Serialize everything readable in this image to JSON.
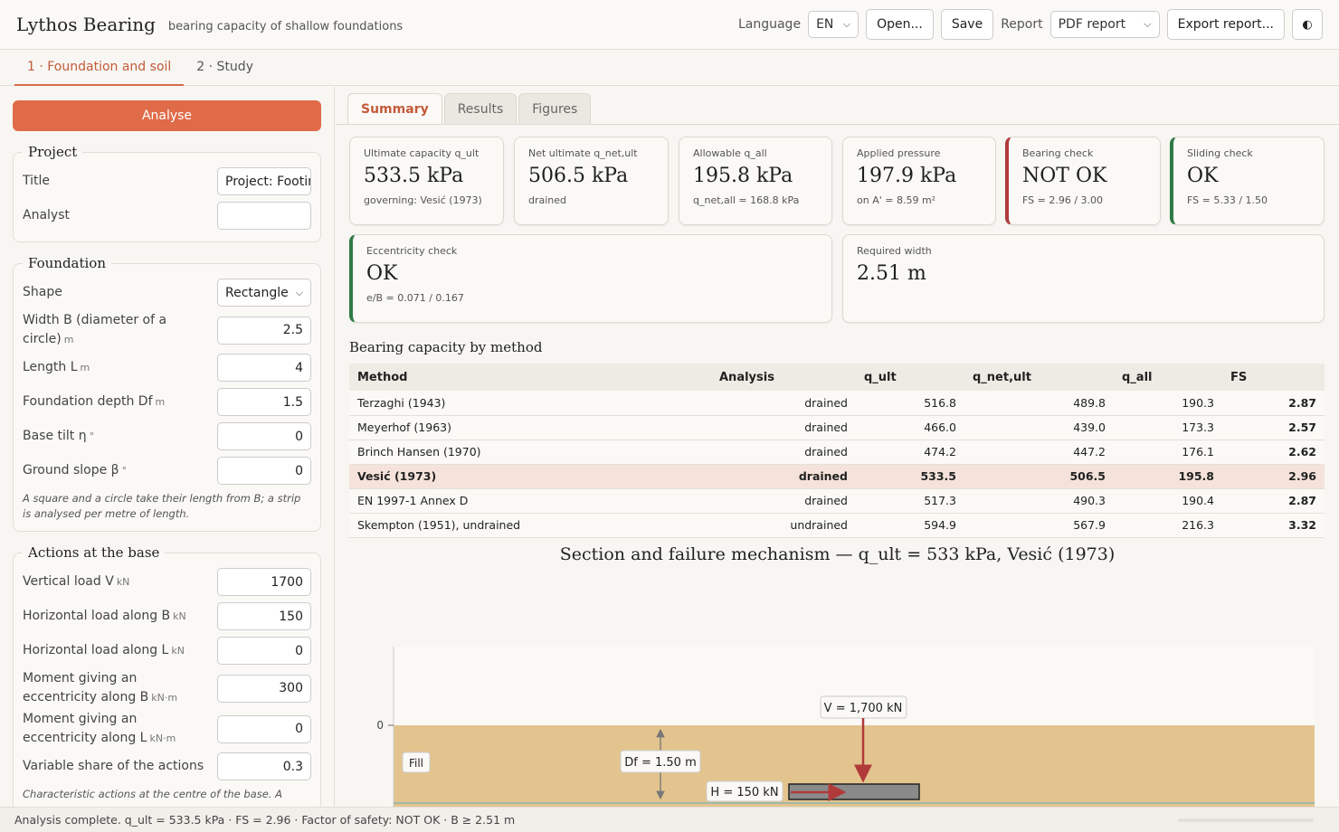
{
  "header": {
    "title": "Lythos Bearing",
    "subtitle": "bearing capacity of shallow foundations",
    "language_label": "Language",
    "language_value": "EN",
    "open_label": "Open...",
    "save_label": "Save",
    "report_label": "Report",
    "report_value": "PDF report",
    "export_label": "Export report...",
    "theme_icon": "◐"
  },
  "steps": [
    {
      "label": "1 · Foundation and soil",
      "active": true
    },
    {
      "label": "2 · Study",
      "active": false
    }
  ],
  "sidebar": {
    "analyse_label": "Analyse",
    "project": {
      "legend": "Project",
      "title_label": "Title",
      "title_value": "Project: Footing",
      "analyst_label": "Analyst",
      "analyst_value": ""
    },
    "foundation": {
      "legend": "Foundation",
      "shape_label": "Shape",
      "shape_value": "Rectangle",
      "width_label": "Width B (diameter of a circle)",
      "width_unit": "m",
      "width_value": "2.5",
      "length_label": "Length L",
      "length_unit": "m",
      "length_value": "4",
      "depth_label": "Foundation depth Df",
      "depth_unit": "m",
      "depth_value": "1.5",
      "tilt_label": "Base tilt η",
      "tilt_unit": "°",
      "tilt_value": "0",
      "slope_label": "Ground slope β",
      "slope_unit": "°",
      "slope_value": "0",
      "note": "A square and a circle take their length from B; a strip is analysed per metre of length."
    },
    "actions": {
      "legend": "Actions at the base",
      "v_label": "Vertical load V",
      "v_unit": "kN",
      "v_value": "1700",
      "hb_label": "Horizontal load along B",
      "hb_unit": "kN",
      "hb_value": "150",
      "hl_label": "Horizontal load along L",
      "hl_unit": "kN",
      "hl_value": "0",
      "mb_label": "Moment giving an eccentricity along B",
      "mb_unit": "kN·m",
      "mb_value": "300",
      "ml_label": "Moment giving an eccentricity along L",
      "ml_unit": "kN·m",
      "ml_value": "0",
      "var_label": "Variable share of the actions",
      "var_value": "0.3",
      "note": "Characteristic actions at the centre of the base. A"
    }
  },
  "tabs": [
    {
      "label": "Summary",
      "active": true
    },
    {
      "label": "Results",
      "active": false
    },
    {
      "label": "Figures",
      "active": false
    }
  ],
  "cards": {
    "qult": {
      "title": "Ultimate capacity q_ult",
      "value": "533.5 kPa",
      "sub": "governing: Vesić (1973)"
    },
    "qnet": {
      "title": "Net ultimate q_net,ult",
      "value": "506.5 kPa",
      "sub": "drained"
    },
    "qall": {
      "title": "Allowable q_all",
      "value": "195.8 kPa",
      "sub": "q_net,all = 168.8 kPa"
    },
    "applied": {
      "title": "Applied pressure",
      "value": "197.9 kPa",
      "sub": "on A' = 8.59 m²"
    },
    "bearing": {
      "title": "Bearing check",
      "value": "NOT OK",
      "sub": "FS = 2.96 / 3.00"
    },
    "sliding": {
      "title": "Sliding check",
      "value": "OK",
      "sub": "FS = 5.33 / 1.50"
    },
    "ecc": {
      "title": "Eccentricity check",
      "value": "OK",
      "sub": "e/B = 0.071 / 0.167"
    },
    "width": {
      "title": "Required width",
      "value": "2.51 m"
    }
  },
  "methods": {
    "title": "Bearing capacity by method",
    "columns": [
      "Method",
      "Analysis",
      "q_ult",
      "q_net,ult",
      "q_all",
      "FS"
    ],
    "rows": [
      {
        "method": "Terzaghi (1943)",
        "analysis": "drained",
        "qult": "516.8",
        "qnet": "489.8",
        "qall": "190.3",
        "fs": "2.87",
        "ok": false,
        "highlight": false
      },
      {
        "method": "Meyerhof (1963)",
        "analysis": "drained",
        "qult": "466.0",
        "qnet": "439.0",
        "qall": "173.3",
        "fs": "2.57",
        "ok": false,
        "highlight": false
      },
      {
        "method": "Brinch Hansen (1970)",
        "analysis": "drained",
        "qult": "474.2",
        "qnet": "447.2",
        "qall": "176.1",
        "fs": "2.62",
        "ok": false,
        "highlight": false
      },
      {
        "method": "Vesić (1973)",
        "analysis": "drained",
        "qult": "533.5",
        "qnet": "506.5",
        "qall": "195.8",
        "fs": "2.96",
        "ok": false,
        "highlight": true
      },
      {
        "method": "EN 1997-1 Annex D",
        "analysis": "drained",
        "qult": "517.3",
        "qnet": "490.3",
        "qall": "190.4",
        "fs": "2.87",
        "ok": false,
        "highlight": false
      },
      {
        "method": "Skempton (1951), undrained",
        "analysis": "undrained",
        "qult": "594.9",
        "qnet": "567.9",
        "qall": "216.3",
        "fs": "3.32",
        "ok": true,
        "highlight": false
      }
    ]
  },
  "figure": {
    "title": "Section and failure mechanism — q_ult = 533 kPa, Vesić (1973)",
    "y_tick": "0",
    "fill_label": "Fill",
    "v_label": "V = 1,700 kN",
    "df_label": "Df = 1.50 m",
    "h_label": "H = 150 kN",
    "colors": {
      "soil": "#e3c48e",
      "footing": "#8a8a8a",
      "arrow": "#b03a3a"
    }
  },
  "status": "Analysis complete. q_ult = 533.5 kPa · FS = 2.96 · Factor of safety: NOT OK · B ≥ 2.51 m"
}
